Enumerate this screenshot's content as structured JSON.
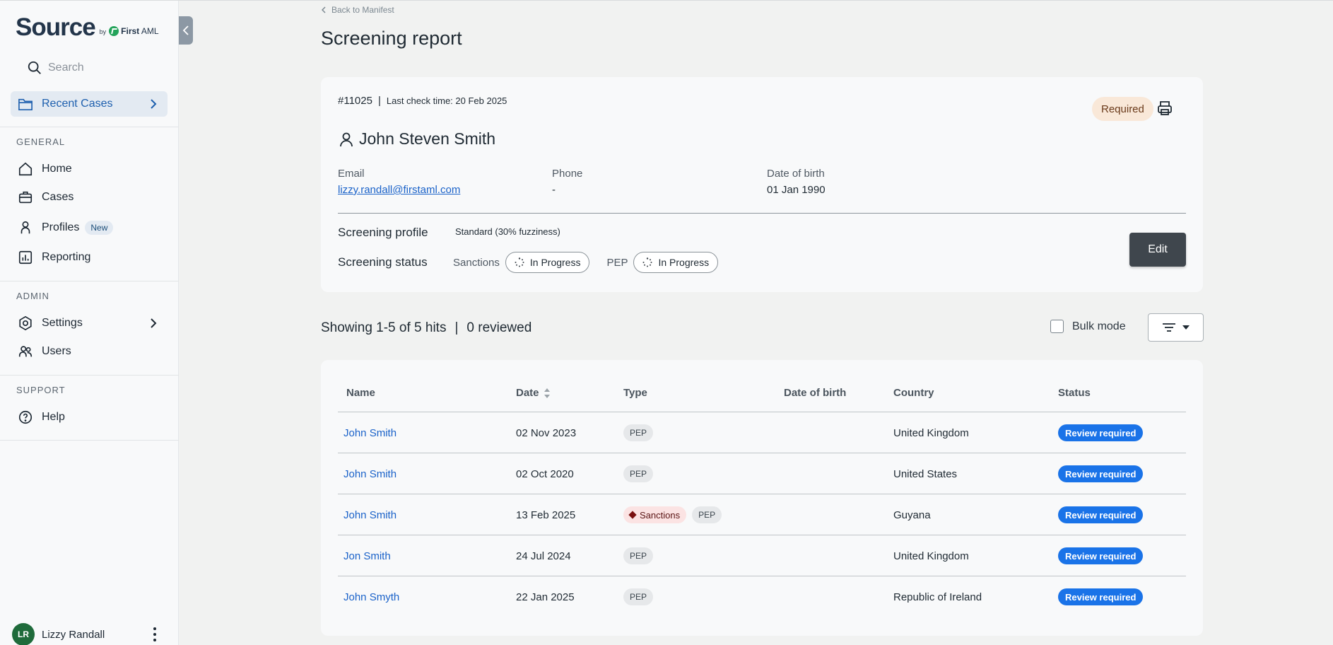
{
  "brand": {
    "name": "Source",
    "by": "by",
    "company_bold": "First",
    "company_rest": "AML"
  },
  "search": {
    "placeholder": "Search"
  },
  "sidebar": {
    "recent_cases": "Recent Cases",
    "general_title": "GENERAL",
    "general_items": [
      {
        "label": "Home"
      },
      {
        "label": "Cases"
      },
      {
        "label": "Profiles",
        "badge": "New"
      },
      {
        "label": "Reporting"
      }
    ],
    "admin_title": "ADMIN",
    "admin_items": [
      {
        "label": "Settings"
      },
      {
        "label": "Users"
      }
    ],
    "support_title": "SUPPORT",
    "support_items": [
      {
        "label": "Help"
      }
    ]
  },
  "user": {
    "initials": "LR",
    "name": "Lizzy Randall"
  },
  "page": {
    "back_link": "Back to Manifest",
    "title": "Screening report"
  },
  "case": {
    "id": "#11025",
    "separator": "|",
    "last_check": "Last check time: 20 Feb 2025",
    "status": "Required",
    "person_name": "John Steven Smith",
    "email_label": "Email",
    "email": "lizzy.randall@firstaml.com",
    "phone_label": "Phone",
    "phone": "-",
    "dob_label": "Date of birth",
    "dob": "01 Jan 1990",
    "screening_profile_label": "Screening profile",
    "screening_profile": "Standard (30% fuzziness)",
    "screening_status_label": "Screening status",
    "sanctions_label": "Sanctions",
    "sanctions_status": "In Progress",
    "pep_label": "PEP",
    "pep_status": "In Progress",
    "edit_label": "Edit"
  },
  "hits": {
    "showing": "Showing 1-5 of 5 hits",
    "divider": "|",
    "reviewed": "0 reviewed",
    "bulk_mode": "Bulk mode"
  },
  "table": {
    "columns": [
      "Name",
      "Date",
      "Type",
      "Date of birth",
      "Country",
      "Status"
    ],
    "rows": [
      {
        "name": "John Smith",
        "date": "02 Nov 2023",
        "types": [
          "PEP"
        ],
        "dob": "",
        "country": "United Kingdom",
        "status": "Review required"
      },
      {
        "name": "John Smith",
        "date": "02 Oct 2020",
        "types": [
          "PEP"
        ],
        "dob": "",
        "country": "United States",
        "status": "Review required"
      },
      {
        "name": "John Smith",
        "date": "13 Feb 2025",
        "types": [
          "Sanctions",
          "PEP"
        ],
        "dob": "",
        "country": "Guyana",
        "status": "Review required"
      },
      {
        "name": "Jon Smith",
        "date": "24 Jul 2024",
        "types": [
          "PEP"
        ],
        "dob": "",
        "country": "United Kingdom",
        "status": "Review required"
      },
      {
        "name": "John Smyth",
        "date": "22 Jan 2025",
        "types": [
          "PEP"
        ],
        "dob": "",
        "country": "Republic of Ireland",
        "status": "Review required"
      }
    ]
  },
  "colors": {
    "accent": "#1a73e8",
    "link": "#1a62c9",
    "required_bg": "#f9e8d8",
    "sanctions_bg": "#fbe3e3",
    "edit_bg": "#3f464d"
  }
}
